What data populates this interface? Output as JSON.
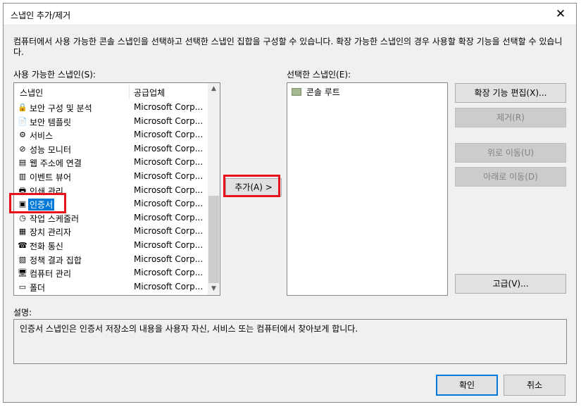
{
  "window": {
    "title": "스냅인 추가/제거",
    "close_glyph": "✕"
  },
  "description": "컴퓨터에서 사용 가능한 콘솔 스냅인을 선택하고 선택한 스냅인 집합을 구성할 수 있습니다. 확장 가능한 스냅인의 경우 사용할 확장 기능을 선택할 수 있습니다.",
  "available": {
    "label": "사용 가능한 스냅인(S):",
    "columns": [
      "스냅인",
      "공급업체"
    ],
    "rows": [
      {
        "name": "보안 구성 및 분석",
        "vendor": "Microsoft Corp...",
        "icon": "security-analysis-icon",
        "glyph": "🔒"
      },
      {
        "name": "보안 템플릿",
        "vendor": "Microsoft Corp...",
        "icon": "security-template-icon",
        "glyph": "📄"
      },
      {
        "name": "서비스",
        "vendor": "Microsoft Corp...",
        "icon": "services-gear-icon",
        "glyph": "⚙"
      },
      {
        "name": "성능 모니터",
        "vendor": "Microsoft Corp...",
        "icon": "performance-monitor-icon",
        "glyph": "⊘"
      },
      {
        "name": "웹 주소에 연결",
        "vendor": "Microsoft Corp...",
        "icon": "web-link-icon",
        "glyph": "▤"
      },
      {
        "name": "이벤트 뷰어",
        "vendor": "Microsoft Corp...",
        "icon": "event-viewer-icon",
        "glyph": "▥"
      },
      {
        "name": "인쇄 관리",
        "vendor": "Microsoft Corp...",
        "icon": "print-management-icon",
        "glyph": "🖶"
      },
      {
        "name": "인증서",
        "vendor": "Microsoft Corp...",
        "icon": "certificate-icon",
        "glyph": "▣",
        "selected": true
      },
      {
        "name": "작업 스케줄러",
        "vendor": "Microsoft Corp...",
        "icon": "task-scheduler-clock-icon",
        "glyph": "◷"
      },
      {
        "name": "장치 관리자",
        "vendor": "Microsoft Corp...",
        "icon": "device-manager-icon",
        "glyph": "▦"
      },
      {
        "name": "전화 통신",
        "vendor": "Microsoft Corp...",
        "icon": "telephony-icon",
        "glyph": "☎"
      },
      {
        "name": "정책 결과 집합",
        "vendor": "Microsoft Corp...",
        "icon": "policy-results-icon",
        "glyph": "▧"
      },
      {
        "name": "컴퓨터 관리",
        "vendor": "Microsoft Corp...",
        "icon": "computer-management-icon",
        "glyph": "🖥"
      },
      {
        "name": "폴더",
        "vendor": "Microsoft Corp...",
        "icon": "folder-icon",
        "glyph": "▭"
      }
    ]
  },
  "add_button": "추가(A) >",
  "selected": {
    "label": "선택한 스냅인(E):",
    "items": [
      {
        "name": "콘솔 루트",
        "icon": "console-root-folder-icon"
      }
    ]
  },
  "buttons": {
    "edit_extensions": "확장 기능 편집(X)...",
    "remove": "제거(R)",
    "move_up": "위로 이동(U)",
    "move_down": "아래로 이동(D)",
    "advanced": "고급(V)...",
    "ok": "확인",
    "cancel": "취소"
  },
  "info": {
    "label": "설명:",
    "text": "인증서 스냅인은 인증서 저장소의 내용을 사용자 자신, 서비스 또는 컴퓨터에서 찾아보게 합니다."
  },
  "colors": {
    "highlight": "#e8131a",
    "selection": "#0078d7"
  }
}
